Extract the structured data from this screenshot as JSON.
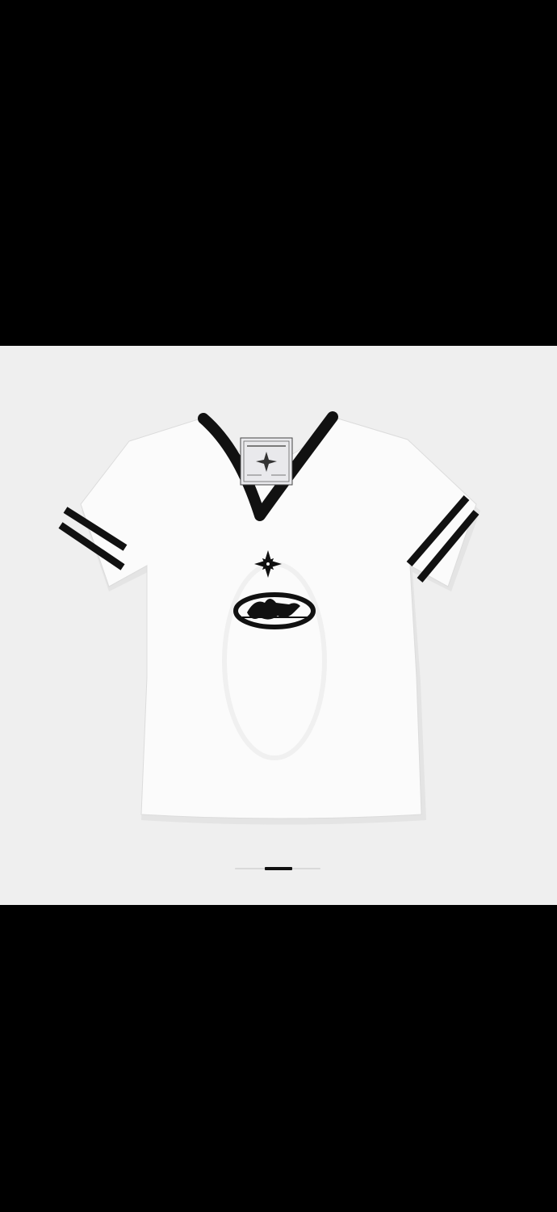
{
  "viewer": {
    "background_color": "#efefef",
    "letterbox_color": "#000000"
  },
  "product": {
    "image_description_icon": "v-neck-tshirt-image",
    "shirt_color": "#fbfbfb",
    "trim_color": "#111111",
    "chest_graphics": [
      "compass-star-icon",
      "oval-lion-emblem-icon"
    ],
    "label": "neck-label-icon"
  },
  "carousel": {
    "total_pages": 3,
    "current_page": 2
  }
}
